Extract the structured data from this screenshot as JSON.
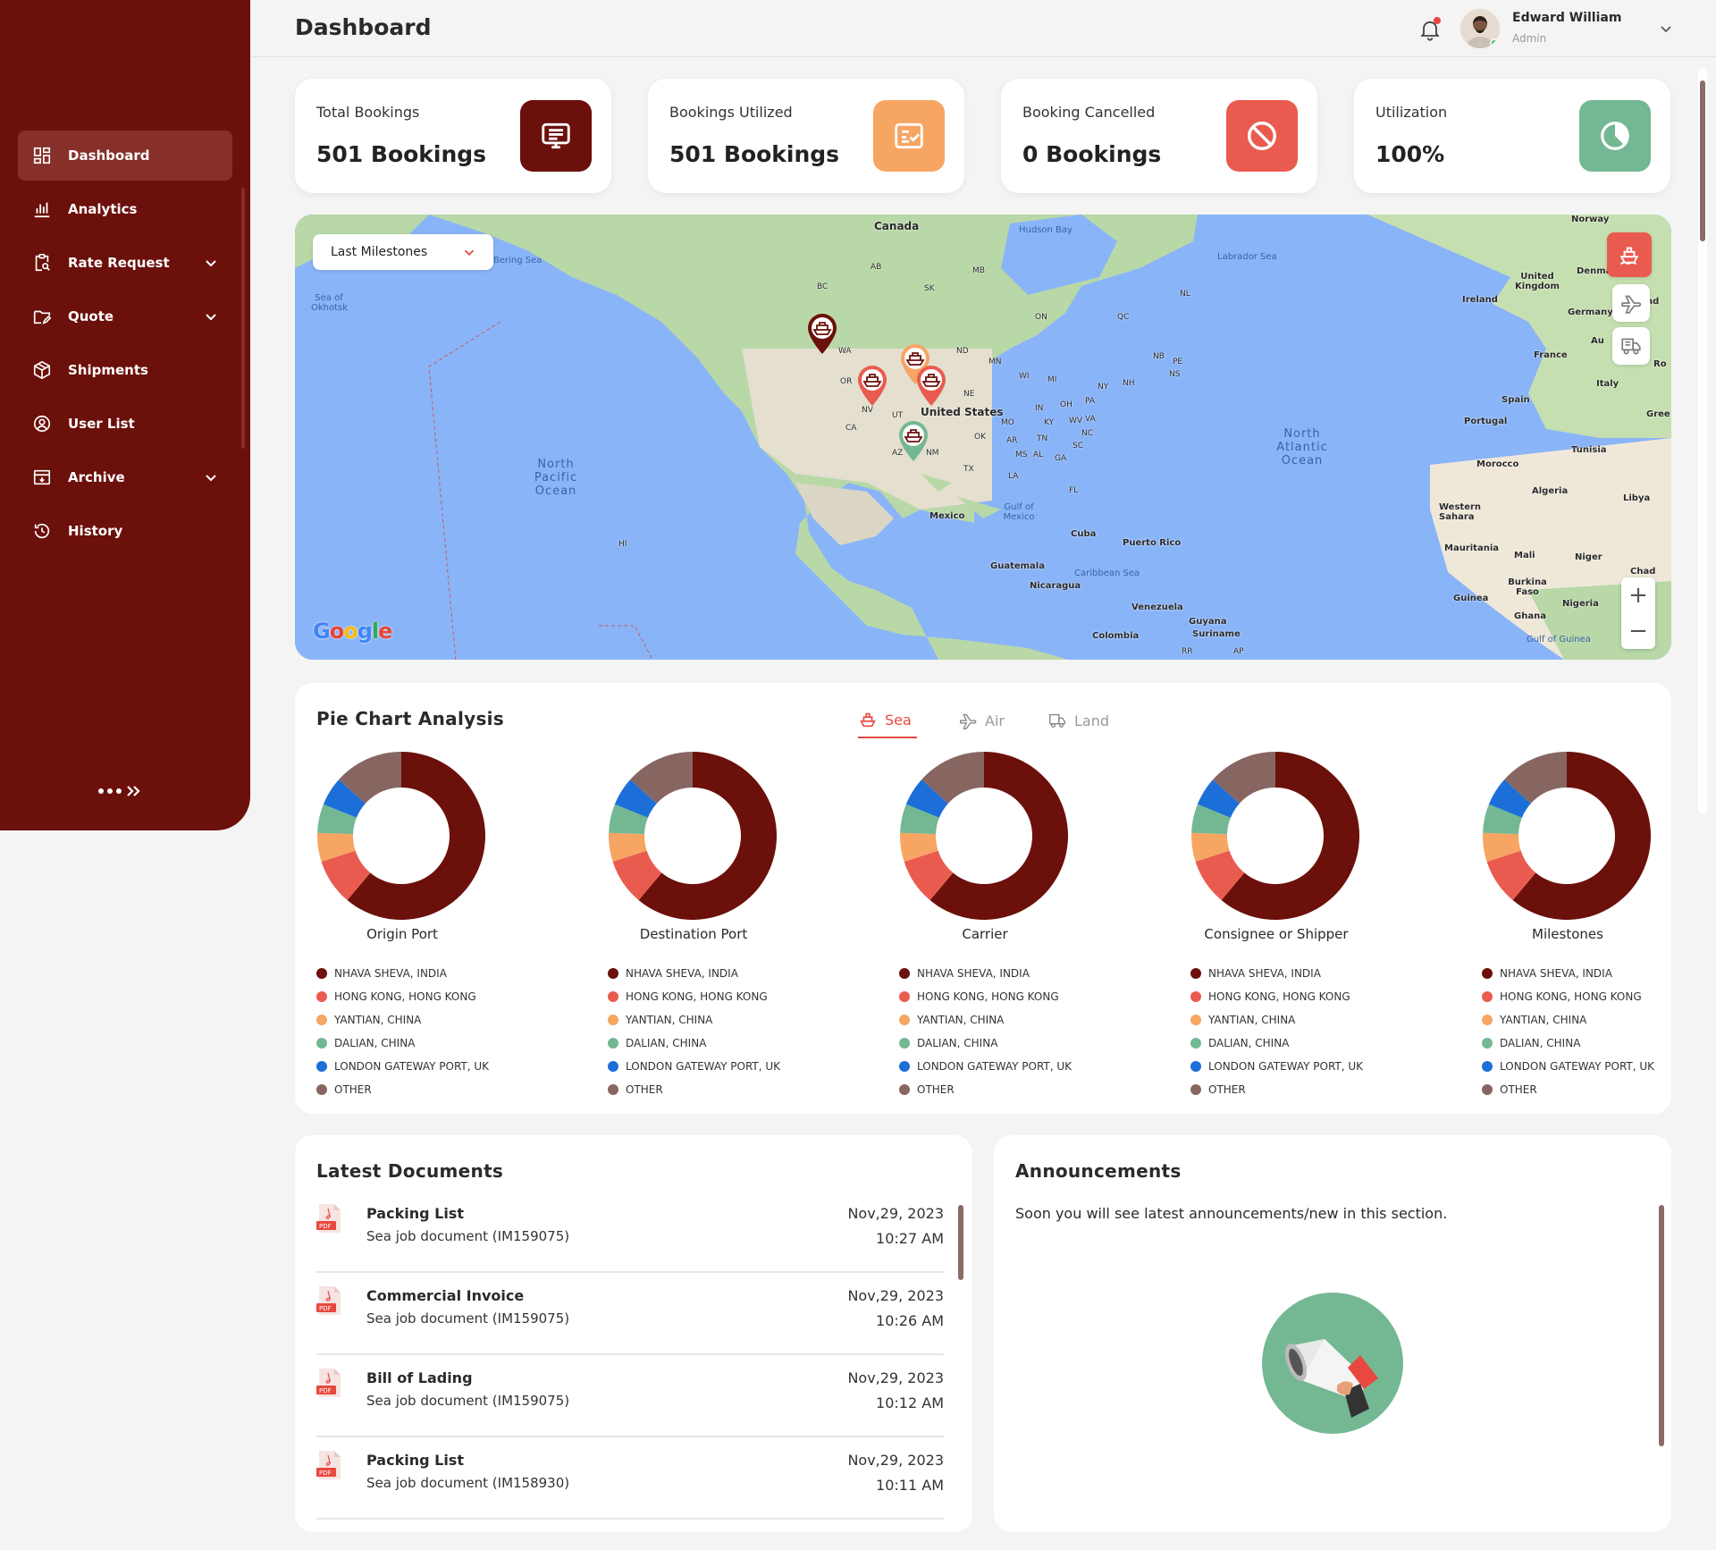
{
  "sidebar": {
    "items": [
      {
        "label": "Dashboard",
        "icon": "dashboard-grid-icon",
        "active": true
      },
      {
        "label": "Analytics",
        "icon": "bar-chart-icon"
      },
      {
        "label": "Rate Request",
        "icon": "clipboard-search-icon",
        "expandable": true
      },
      {
        "label": "Quote",
        "icon": "folder-edit-icon",
        "expandable": true
      },
      {
        "label": "Shipments",
        "icon": "box-icon"
      },
      {
        "label": "User List",
        "icon": "user-circle-icon"
      },
      {
        "label": "Archive",
        "icon": "archive-icon",
        "expandable": true
      },
      {
        "label": "History",
        "icon": "history-icon"
      }
    ],
    "collapse_icon": "collapse-dots-icon"
  },
  "header": {
    "title": "Dashboard",
    "user": {
      "name": "Edward William",
      "role": "Admin"
    }
  },
  "stats": [
    {
      "title": "Total Bookings",
      "value": "501 Bookings",
      "icon": "booking-list-icon",
      "color": "#6b100b"
    },
    {
      "title": "Bookings Utilized",
      "value": "501 Bookings",
      "icon": "checklist-icon",
      "color": "#f7a563"
    },
    {
      "title": "Booking Cancelled",
      "value": "0 Bookings",
      "icon": "cancel-icon",
      "color": "#ea5b4f"
    },
    {
      "title": "Utilization",
      "value": "100%",
      "icon": "pie-icon",
      "color": "#74b893"
    }
  ],
  "map": {
    "dropdown": "Last Milestones",
    "labels": {
      "canada": "Canada",
      "hudson_bay": "Hudson Bay",
      "labrador_sea": "Labrador Sea",
      "norway": "Norway",
      "bering_sea": "Bering Sea",
      "sea_okhotsk": "Sea of Okhotsk",
      "united_kingdom": "United Kingdom",
      "ireland": "Ireland",
      "denmark": "Denma",
      "germany": "Germany",
      "france": "France",
      "italy": "Italy",
      "spain": "Spain",
      "portugal": "Portugal",
      "greece": "Gree",
      "ro": "Ro",
      "au": "Au",
      "nd": "nd",
      "united_states": "United States",
      "north_pacific": "North Pacific Ocean",
      "north_atlantic": "North Atlantic Ocean",
      "tunisia": "Tunisia",
      "morocco": "Morocco",
      "algeria": "Algeria",
      "libya": "Libya",
      "western_sahara": "Western Sahara",
      "mauritania": "Mauritania",
      "mali": "Mali",
      "niger": "Niger",
      "chad": "Chad",
      "mexico": "Mexico",
      "gulf_mexico": "Gulf of Mexico",
      "cuba": "Cuba",
      "puerto_rico": "Puerto Rico",
      "guatemala": "Guatemala",
      "nicaragua": "Nicaragua",
      "caribbean": "Caribbean Sea",
      "venezuela": "Venezuela",
      "guyana": "Guyana",
      "suriname": "Suriname",
      "colombia": "Colombia",
      "burkina": "Burkina Faso",
      "guinea": "Guinea",
      "ghana": "Ghana",
      "nigeria": "Nigeria",
      "gulf_guinea": "Gulf of Guinea",
      "hi": "HI",
      "wa": "WA",
      "or": "OR",
      "nv": "NV",
      "ca": "CA",
      "ut": "UT",
      "az": "AZ",
      "nm": "NM",
      "tx": "TX",
      "nd_state": "ND",
      "ne": "NE",
      "mn": "MN",
      "ok": "OK",
      "mo": "MO",
      "in": "IN",
      "oh": "OH",
      "wv": "WV",
      "ky": "KY",
      "tn": "TN",
      "ms": "MS",
      "al": "AL",
      "ga": "GA",
      "sc": "SC",
      "nc": "NC",
      "va": "VA",
      "ny": "NY",
      "pa": "PA",
      "mi": "MI",
      "wi": "WI",
      "la": "LA",
      "fl": "FL",
      "nh": "NH",
      "bc": "BC",
      "ab": "AB",
      "sk": "SK",
      "mb": "MB",
      "on": "ON",
      "qc": "QC",
      "nl": "NL",
      "nb": "NB",
      "pe": "PE",
      "ns": "NS",
      "ar": "AR",
      "ap": "AP",
      "rr": "RR"
    },
    "google": "Google",
    "zoom_in": "+",
    "zoom_out": "−",
    "pins": [
      "#6b100b",
      "#ea5b4f",
      "#f7a563",
      "#ea5b4f",
      "#74b893"
    ]
  },
  "pie_section": {
    "title": "Pie Chart Analysis",
    "tabs": [
      {
        "label": "Sea",
        "icon": "ship-icon",
        "active": true
      },
      {
        "label": "Air",
        "icon": "plane-icon"
      },
      {
        "label": "Land",
        "icon": "truck-icon"
      }
    ],
    "legend": [
      {
        "label": "NHAVA SHEVA, INDIA",
        "color": "#6b100b"
      },
      {
        "label": "HONG KONG, HONG KONG",
        "color": "#ea5b4f"
      },
      {
        "label": "YANTIAN, CHINA",
        "color": "#f7a563"
      },
      {
        "label": "DALIAN, CHINA",
        "color": "#74b893"
      },
      {
        "label": "LONDON GATEWAY PORT, UK",
        "color": "#1c6fd8"
      },
      {
        "label": "OTHER",
        "color": "#876662"
      }
    ]
  },
  "chart_data": [
    {
      "type": "pie",
      "title": "Origin Port",
      "categories": [
        "NHAVA SHEVA, INDIA",
        "HONG KONG, HONG KONG",
        "YANTIAN, CHINA",
        "DALIAN, CHINA",
        "LONDON GATEWAY PORT, UK",
        "OTHER"
      ],
      "values": [
        55,
        8,
        5,
        5,
        5,
        12
      ]
    },
    {
      "type": "pie",
      "title": "Destination Port",
      "categories": [
        "NHAVA SHEVA, INDIA",
        "HONG KONG, HONG KONG",
        "YANTIAN, CHINA",
        "DALIAN, CHINA",
        "LONDON GATEWAY PORT, UK",
        "OTHER"
      ],
      "values": [
        55,
        8,
        5,
        5,
        5,
        12
      ]
    },
    {
      "type": "pie",
      "title": "Carrier",
      "categories": [
        "NHAVA SHEVA, INDIA",
        "HONG KONG, HONG KONG",
        "YANTIAN, CHINA",
        "DALIAN, CHINA",
        "LONDON GATEWAY PORT, UK",
        "OTHER"
      ],
      "values": [
        55,
        8,
        5,
        5,
        5,
        12
      ]
    },
    {
      "type": "pie",
      "title": "Consignee or Shipper",
      "categories": [
        "NHAVA SHEVA, INDIA",
        "HONG KONG, HONG KONG",
        "YANTIAN, CHINA",
        "DALIAN, CHINA",
        "LONDON GATEWAY PORT, UK",
        "OTHER"
      ],
      "values": [
        55,
        8,
        5,
        5,
        5,
        12
      ]
    },
    {
      "type": "pie",
      "title": "Milestones",
      "categories": [
        "NHAVA SHEVA, INDIA",
        "HONG KONG, HONG KONG",
        "YANTIAN, CHINA",
        "DALIAN, CHINA",
        "LONDON GATEWAY PORT, UK",
        "OTHER"
      ],
      "values": [
        55,
        8,
        5,
        5,
        5,
        12
      ]
    }
  ],
  "documents": {
    "title": "Latest Documents",
    "items": [
      {
        "title": "Packing List",
        "subtitle": "Sea job document (IM159075)",
        "date": "Nov,29, 2023",
        "time": "10:27 AM"
      },
      {
        "title": "Commercial Invoice",
        "subtitle": "Sea job document (IM159075)",
        "date": "Nov,29, 2023",
        "time": "10:26 AM"
      },
      {
        "title": "Bill of Lading",
        "subtitle": "Sea job document (IM159075)",
        "date": "Nov,29, 2023",
        "time": "10:12 AM"
      },
      {
        "title": "Packing List",
        "subtitle": "Sea job document (IM158930)",
        "date": "Nov,29, 2023",
        "time": "10:11 AM"
      }
    ]
  },
  "announcements": {
    "title": "Announcements",
    "text": "Soon you will see latest announcements/new in this section."
  }
}
